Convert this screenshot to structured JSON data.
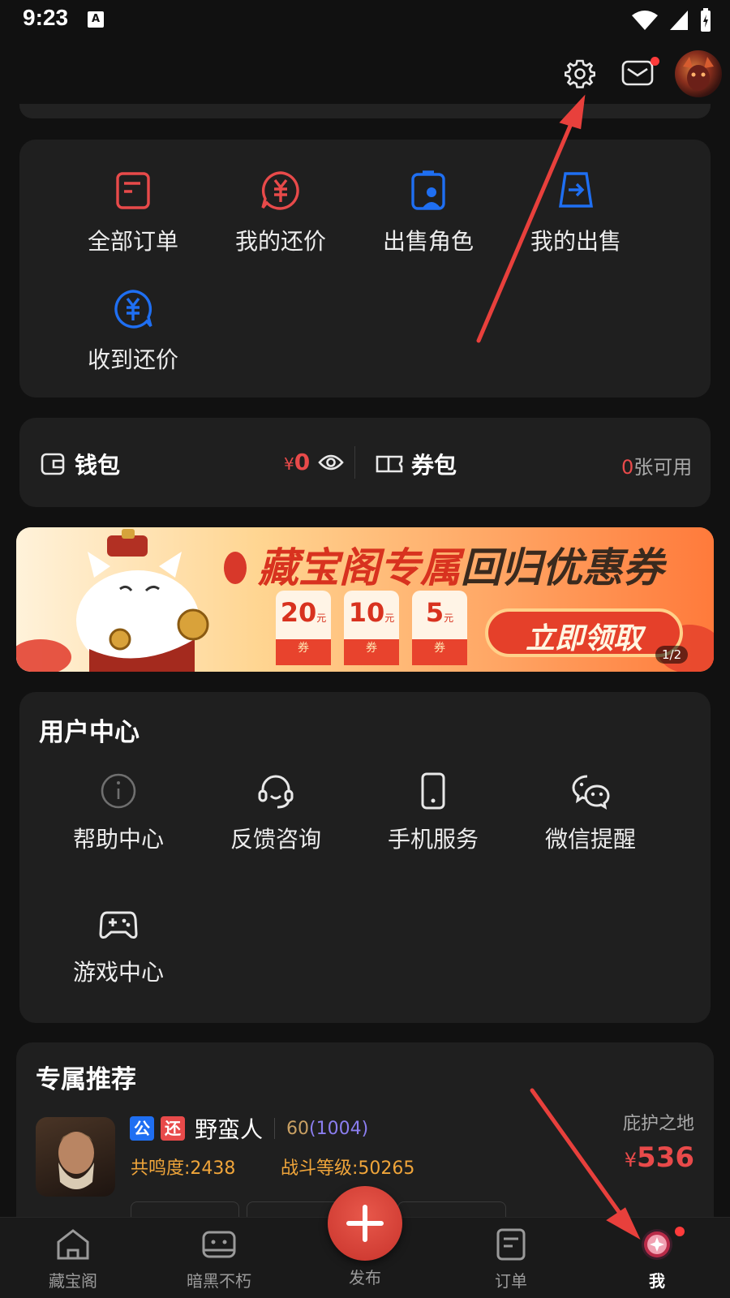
{
  "status_bar": {
    "time": "9:23",
    "a_badge": "A"
  },
  "orders": {
    "items": [
      {
        "label": "全部订单",
        "icon": "order-list-icon"
      },
      {
        "label": "我的还价",
        "icon": "counter-offer-icon"
      },
      {
        "label": "出售角色",
        "icon": "sell-character-icon"
      },
      {
        "label": "我的出售",
        "icon": "my-sales-icon"
      },
      {
        "label": "收到还价",
        "icon": "received-offer-icon"
      }
    ]
  },
  "wallet": {
    "label": "钱包",
    "currency": "¥",
    "amount": "0",
    "coupon_label": "券包",
    "coupon_count": "0",
    "coupon_suffix": "张可用"
  },
  "banner": {
    "title_a": "藏宝阁专属",
    "title_b": "回归优惠券",
    "coupons": [
      {
        "value": "20",
        "unit": "元",
        "tag": "券"
      },
      {
        "value": "10",
        "unit": "元",
        "tag": "券"
      },
      {
        "value": "5",
        "unit": "元",
        "tag": "券"
      }
    ],
    "cta": "立即领取",
    "pager": "1/2"
  },
  "user_center": {
    "title": "用户中心",
    "items": [
      {
        "label": "帮助中心",
        "icon": "info-icon"
      },
      {
        "label": "反馈咨询",
        "icon": "headset-icon"
      },
      {
        "label": "手机服务",
        "icon": "phone-icon"
      },
      {
        "label": "微信提醒",
        "icon": "wechat-icon"
      },
      {
        "label": "游戏中心",
        "icon": "gamepad-icon"
      }
    ]
  },
  "recommend": {
    "title": "专属推荐",
    "item": {
      "tag_public": "公",
      "tag_return": "还",
      "name": "野蛮人",
      "level": "60",
      "level_extra": "(1004)",
      "resonance": "共鸣度:2438",
      "combat": "战斗等级:50265",
      "server": "庇护之地",
      "currency": "¥",
      "price": "536"
    }
  },
  "bottom_nav": {
    "items": [
      {
        "label": "藏宝阁",
        "icon": "home-icon"
      },
      {
        "label": "暗黑不朽",
        "icon": "game-face-icon"
      },
      {
        "label": "发布",
        "icon": "plus-icon"
      },
      {
        "label": "订单",
        "icon": "order-icon"
      },
      {
        "label": "我",
        "icon": "me-icon"
      }
    ]
  },
  "colors": {
    "background": "#111111",
    "card": "#1f1f1f",
    "accent_red": "#e84a4a",
    "accent_blue": "#1f6ff2",
    "gold": "#f0a53a",
    "annotation_arrow": "#e8403c"
  }
}
